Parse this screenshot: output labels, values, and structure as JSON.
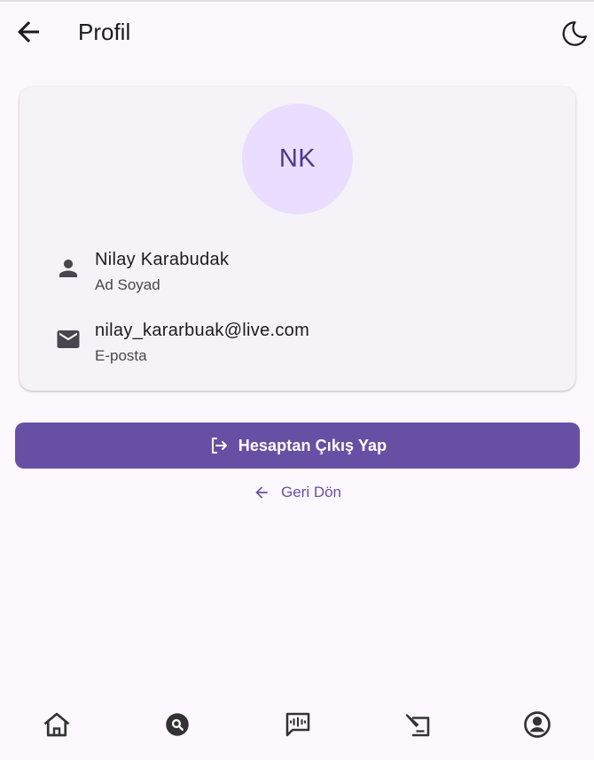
{
  "appbar": {
    "title": "Profil",
    "back_icon": "arrow-back-icon",
    "theme_icon": "dark-mode-moon-icon"
  },
  "profile": {
    "initials": "NK",
    "name": "Nilay Karabudak",
    "name_label": "Ad Soyad",
    "email": "nilay_kararbuak@live.com",
    "email_label": "E-posta"
  },
  "actions": {
    "logout_label": "Hesaptan Çıkış Yap",
    "logout_icon": "logout-icon",
    "back_label": "Geri Dön",
    "back_icon": "arrow-back-icon"
  },
  "bottom_nav": {
    "items": [
      {
        "icon": "home-icon"
      },
      {
        "icon": "search-icon"
      },
      {
        "icon": "voice-chat-icon"
      },
      {
        "icon": "edit-document-icon"
      },
      {
        "icon": "account-icon"
      }
    ]
  },
  "colors": {
    "background": "#fdf7fe",
    "primary": "#6750a4",
    "avatar_bg": "#eaddff",
    "card_bg": "#f5f3f7"
  }
}
